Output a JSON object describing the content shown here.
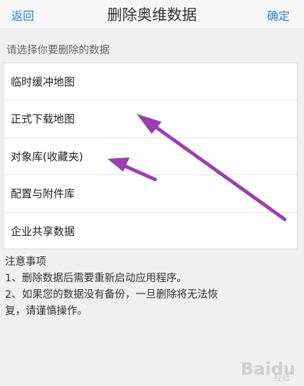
{
  "header": {
    "back_label": "返回",
    "title": "删除奥维数据",
    "confirm_label": "确定"
  },
  "prompt": "请选择你要删除的数据",
  "items": [
    {
      "label": "临时缓冲地图"
    },
    {
      "label": "正式下载地图"
    },
    {
      "label": "对象库(收藏夹)"
    },
    {
      "label": "配置与附件库"
    },
    {
      "label": "企业共享数据"
    }
  ],
  "notes": {
    "title": "注意事项",
    "lines": [
      "1、删除数据后需要重新启动应用程序。",
      "2、如果您的数据没有备份，一旦删除将无法恢",
      "复，请谨慎操作。"
    ]
  },
  "watermark": {
    "brand": "Baidu",
    "sub": "经验"
  },
  "colors": {
    "accent": "#2a7fd4",
    "arrow": "#9b3fb0"
  }
}
